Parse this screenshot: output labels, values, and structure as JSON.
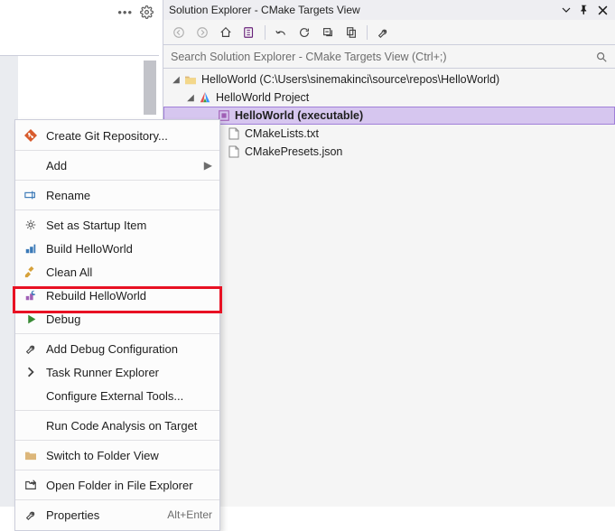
{
  "panel": {
    "title": "Solution Explorer - CMake Targets View",
    "search_placeholder": "Search Solution Explorer - CMake Targets View (Ctrl+;)"
  },
  "tree": {
    "root": {
      "label": "HelloWorld (C:\\Users\\sinemakinci\\source\\repos\\HelloWorld)"
    },
    "project": {
      "label": "HelloWorld Project"
    },
    "exe": {
      "label": "HelloWorld (executable)"
    },
    "file1": {
      "label": "CMakeLists.txt"
    },
    "file2": {
      "label": "CMakePresets.json"
    }
  },
  "menu": {
    "create_repo": "Create Git Repository...",
    "add": "Add",
    "rename": "Rename",
    "startup": "Set as Startup Item",
    "build": "Build HelloWorld",
    "clean": "Clean All",
    "rebuild": "Rebuild HelloWorld",
    "debug": "Debug",
    "add_debug_cfg": "Add Debug Configuration",
    "task_runner": "Task Runner Explorer",
    "configure_tools": "Configure External Tools...",
    "run_analysis": "Run Code Analysis on Target",
    "switch_folder": "Switch to Folder View",
    "open_explorer": "Open Folder in File Explorer",
    "properties": "Properties",
    "properties_shortcut": "Alt+Enter"
  }
}
